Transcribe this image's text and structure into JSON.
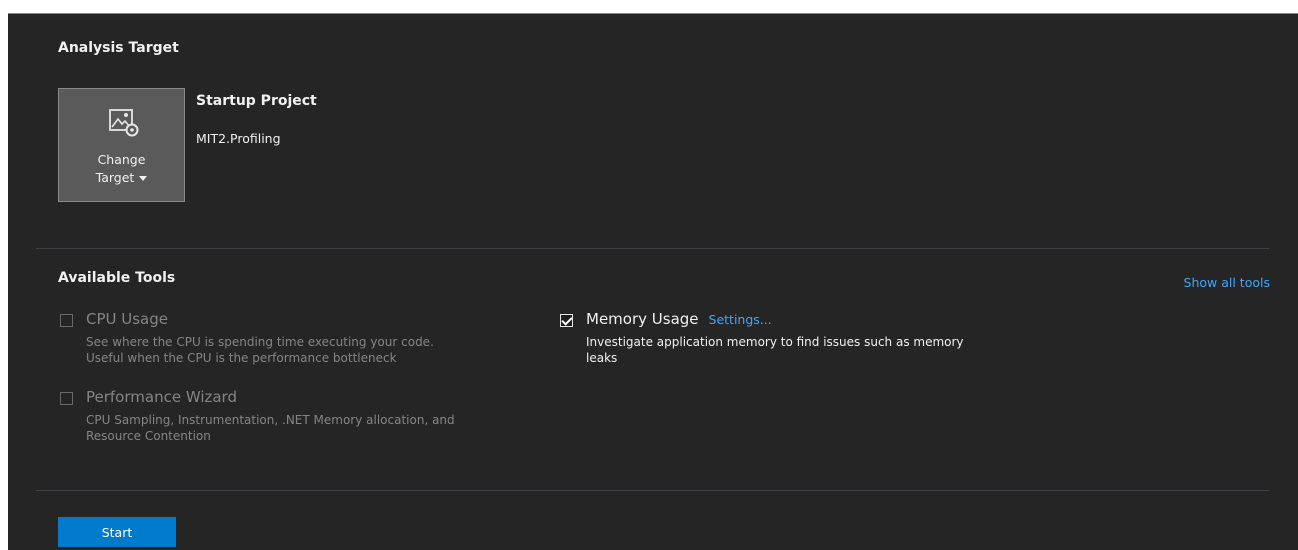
{
  "analysis_target": {
    "title": "Analysis Target",
    "change_target_line1": "Change",
    "change_target_line2": "Target",
    "startup_title": "Startup Project",
    "startup_name": "MIT2.Profiling"
  },
  "available_tools": {
    "title": "Available Tools",
    "show_all": "Show all tools",
    "tools": [
      {
        "name": "CPU Usage",
        "desc1": "See where the CPU is spending time executing your code.",
        "desc2": "Useful when the CPU is the performance bottleneck",
        "checked": false
      },
      {
        "name": "Performance Wizard",
        "desc1": "CPU Sampling, Instrumentation, .NET Memory allocation, and",
        "desc2": "Resource Contention",
        "checked": false
      },
      {
        "name": "Memory Usage",
        "settings": "Settings...",
        "desc1": "Investigate application memory to find issues such as memory",
        "desc2": "leaks",
        "checked": true
      }
    ]
  },
  "start_label": "Start",
  "colors": {
    "accent": "#007acc",
    "link": "#3ea6ff",
    "background": "#252526"
  },
  "icons": {
    "change_target": "image-settings-icon",
    "dropdown": "caret-down-icon"
  }
}
